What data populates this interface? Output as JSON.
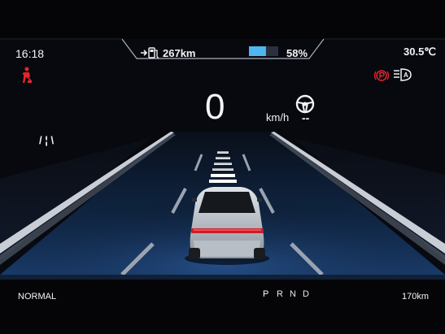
{
  "status": {
    "time": "16:18",
    "range": "267km",
    "battery_percent_text": "58%",
    "battery_level": 0.58,
    "outside_temp": "30.5℃"
  },
  "indicators": {
    "seatbelt_warning_icon": "seatbelt-warning-icon",
    "parking_brake_icon": "parking-brake-icon",
    "auto_headlight_icon": "auto-headlight-icon",
    "lane_keep_icon": "steering-wheel-icon",
    "lane_assist_icon": "lane-assist-icon",
    "lane_assist_text": "/ ¦ \\"
  },
  "speed": {
    "value": "0",
    "unit": "km/h",
    "lane_keep_value": "--"
  },
  "footer": {
    "drive_mode": "NORMAL",
    "gears": [
      "P",
      "R",
      "N",
      "D"
    ],
    "active_gear": "P",
    "odometer": "170km"
  },
  "colors": {
    "warning_red": "#e0262d",
    "battery_blue": "#4fb6f0",
    "text_white": "#f2f4f7",
    "road_glow": "#3a6fb0"
  }
}
